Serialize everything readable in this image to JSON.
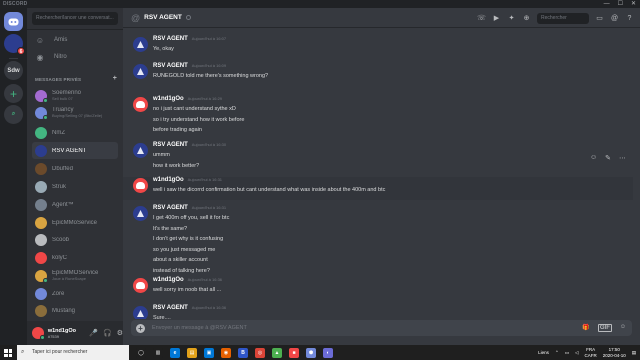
{
  "window": {
    "app_name": "DISCORD",
    "controls": [
      "—",
      "☐",
      "✕"
    ]
  },
  "rail": {
    "servers": [
      {
        "label": "",
        "icon": "discord-logo-icon",
        "kind": "home"
      },
      {
        "label": "",
        "icon": "server-avatar-icon",
        "badge": "6"
      },
      {
        "label": "Sdw"
      },
      {
        "label": "+",
        "icon": "add-server-icon"
      },
      {
        "label": "⌕",
        "icon": "explore-icon"
      }
    ]
  },
  "sidebar": {
    "search_placeholder": "Rechercher/lancer une conversat...",
    "nav": [
      {
        "label": "Amis",
        "icon": "friends-icon"
      },
      {
        "label": "Nitro",
        "icon": "nitro-icon"
      }
    ],
    "section_title": "MESSAGES PRIVÉS",
    "dms": [
      {
        "name": "Soemerino",
        "sub": "Sell bulk 07",
        "color": "#a46bd1",
        "status": "#43b581"
      },
      {
        "name": "Truancy",
        "sub": "Buying/Selling 07 (Btc/Zelle)",
        "color": "#7289da",
        "status": "#43b581"
      },
      {
        "name": "NmZ",
        "sub": "",
        "color": "#43b581",
        "status": ""
      },
      {
        "name": "RSV AGENT",
        "sub": "",
        "color": "#2c3d8f",
        "status": ""
      },
      {
        "name": "Dbuffed",
        "sub": "",
        "color": "#6b4a2b",
        "status": ""
      },
      {
        "name": "Struk",
        "sub": "",
        "color": "#99aab5",
        "status": ""
      },
      {
        "name": "Agent™",
        "sub": "",
        "color": "#747f8d",
        "status": ""
      },
      {
        "name": "EpicMMoService",
        "sub": "",
        "color": "#d9a441",
        "status": ""
      },
      {
        "name": "Scoob",
        "sub": "",
        "color": "#b9bbbe",
        "status": ""
      },
      {
        "name": "kolyC",
        "sub": "",
        "color": "#f04747",
        "status": ""
      },
      {
        "name": "EpicMMOService",
        "sub": "Joue à RuneScape",
        "color": "#d9a441",
        "status": "#43b581"
      },
      {
        "name": "Zore",
        "sub": "",
        "color": "#7289da",
        "status": ""
      },
      {
        "name": "Mustang",
        "sub": "",
        "color": "#8a6d3b",
        "status": ""
      },
      {
        "name": "CHERUB",
        "sub": "",
        "color": "#c9a227",
        "status": ""
      }
    ]
  },
  "user": {
    "name": "w1nd1gOo",
    "tag": "#7539",
    "controls": [
      "🎤",
      "🎧",
      "⚙"
    ]
  },
  "chat": {
    "channel": "RSV AGENT",
    "search_placeholder": "Rechercher",
    "header_icons": [
      "☏",
      "▶",
      "✦",
      "⊕",
      "▭",
      "@",
      "?"
    ],
    "messages": [
      {
        "author": "RSV AGENT",
        "avatar": "rsv",
        "time": "Aujourd'hui à 16:07",
        "lines": [
          "Ye, okay"
        ]
      },
      {
        "author": "RSV AGENT",
        "avatar": "rsv",
        "time": "Aujourd'hui à 16:09",
        "lines": [
          "RUNEGOLD told me there's something wrong?"
        ]
      },
      {
        "author": "w1nd1gOo",
        "avatar": "w",
        "time": "Aujourd'hui à 16:29",
        "lines": [
          "no i just cant understand sythe xD",
          "so i try understand how it work before",
          "before trading again"
        ]
      },
      {
        "author": "RSV AGENT",
        "avatar": "rsv",
        "time": "Aujourd'hui à 16:30",
        "lines": [
          "ummm",
          "how it work better?"
        ]
      },
      {
        "author": "w1nd1gOo",
        "avatar": "w",
        "time": "Aujourd'hui à 16:31",
        "lines": [
          "well i saw the dicorrd confirmation but cant understand what was inside about the 400m and btc"
        ]
      },
      {
        "author": "RSV AGENT",
        "avatar": "rsv",
        "time": "Aujourd'hui à 16:31",
        "lines": [
          "I get 400m off you, sell it for btc",
          "It's the same?",
          "I don't get why is it confusing",
          "so you just messaged me",
          "about a skiller account",
          "instead of talking here?"
        ]
      },
      {
        "author": "w1nd1gOo",
        "avatar": "w",
        "time": "Aujourd'hui à 16:36",
        "lines": [
          "well sorry im noob that all ..."
        ]
      },
      {
        "author": "RSV AGENT",
        "avatar": "rsv",
        "time": "Aujourd'hui à 16:36",
        "lines": [
          "Sure...."
        ]
      }
    ],
    "hover_tools": [
      "☺",
      "✎",
      "⋯"
    ],
    "composer_placeholder": "Envoyer un message à @RSV AGENT",
    "composer_icons": [
      "🎁",
      "GIF",
      "☺"
    ]
  },
  "taskbar": {
    "search_placeholder": "Taper ici pour rechercher",
    "apps": [
      {
        "label": "◯",
        "color": "#1f1f1f"
      },
      {
        "label": "▥",
        "color": "#1f1f1f"
      },
      {
        "label": "e",
        "color": "#0078d7"
      },
      {
        "label": "▤",
        "color": "#e3a21a"
      },
      {
        "label": "▣",
        "color": "#0078d7"
      },
      {
        "label": "◉",
        "color": "#e66000"
      },
      {
        "label": "B",
        "color": "#2f56c9"
      },
      {
        "label": "◎",
        "color": "#db4437"
      },
      {
        "label": "▲",
        "color": "#4caf50"
      },
      {
        "label": "■",
        "color": "#f04747"
      },
      {
        "label": "⬢",
        "color": "#7289da"
      },
      {
        "label": "◐",
        "color": "#6b6bd6"
      }
    ],
    "tray_links": "Liens",
    "lang_top": "FRA",
    "lang_bottom": "CAFR",
    "time": "17:50",
    "date": "2020-04-10"
  }
}
